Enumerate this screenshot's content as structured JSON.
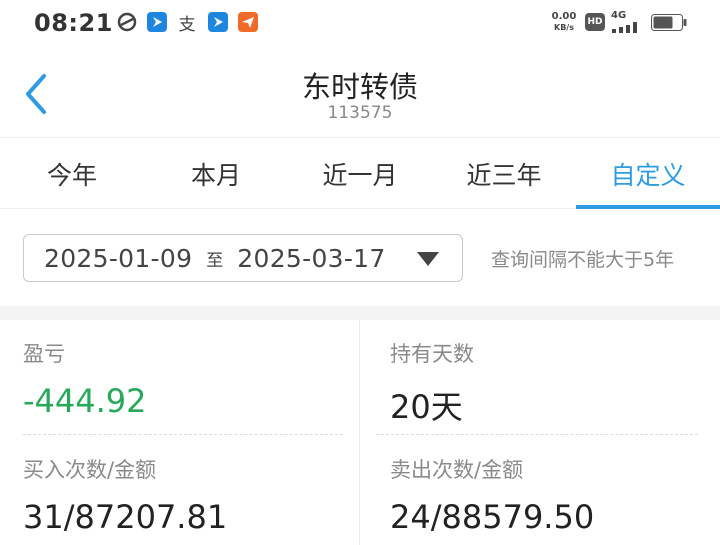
{
  "status_bar": {
    "time": "08:21",
    "app_icons": [
      "swirl-app-icon",
      "blue-arrow-app-icon",
      "alipay-icon",
      "blue-arrow-app-icon",
      "orange-plane-app-icon"
    ],
    "net_speed_value": "0.00",
    "net_speed_unit": "KB/s",
    "hd_label": "HD",
    "network_label": "4G"
  },
  "header": {
    "back_icon": "chevron-left-icon",
    "title": "东时转债",
    "code": "113575"
  },
  "tabs": [
    {
      "label": "今年",
      "active": false
    },
    {
      "label": "本月",
      "active": false
    },
    {
      "label": "近一月",
      "active": false
    },
    {
      "label": "近三年",
      "active": false
    },
    {
      "label": "自定义",
      "active": true
    }
  ],
  "date_range": {
    "start": "2025-01-09",
    "separator": "至",
    "end": "2025-03-17",
    "hint": "查询间隔不能大于5年"
  },
  "stats": {
    "profit_label": "盈亏",
    "profit_value": "-444.92",
    "hold_days_label": "持有天数",
    "hold_days_value": "20天",
    "buy_label": "买入次数/金额",
    "buy_value": "31/87207.81",
    "sell_label": "卖出次数/金额",
    "sell_value": "24/88579.50"
  },
  "colors": {
    "accent": "#2f9be0",
    "loss_green": "#27a85a",
    "muted_text": "#8a8a8a"
  }
}
